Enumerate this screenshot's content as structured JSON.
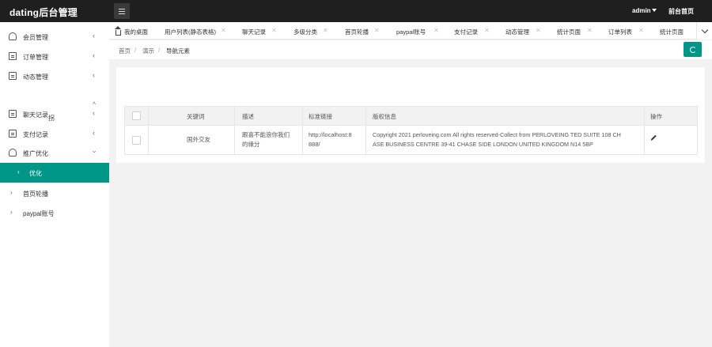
{
  "app": {
    "title": "dating后台管理",
    "user": "admin",
    "front_link": "前台首页"
  },
  "sidebar": {
    "items": [
      {
        "label": "会员管理",
        "icon": "user-icon"
      },
      {
        "label": "订单管理",
        "icon": "doc-icon"
      },
      {
        "label": "动态管理",
        "icon": "doc-icon"
      },
      {
        "label": "聊天记录",
        "icon": "doc-icon"
      },
      {
        "label": "支付记录",
        "icon": "doc-icon"
      },
      {
        "label": "推广优化",
        "icon": "group-icon"
      }
    ],
    "sub_fragment": "拐",
    "active_sub": "优化",
    "extra_items": [
      {
        "label": "首页轮播"
      },
      {
        "label": "paypal账号"
      }
    ]
  },
  "tabs": {
    "home": "我的桌面",
    "items": [
      "用户列表(静态表格)",
      "聊天记录",
      "多级分类",
      "首页轮播",
      "paypal账号",
      "支付记录",
      "动态管理",
      "统计页面",
      "订单列表",
      "统计页面"
    ]
  },
  "breadcrumb": [
    "首页",
    "演示",
    "导航元素"
  ],
  "table": {
    "headers": [
      "关键词",
      "描述",
      "标准链接",
      "版权信息",
      "操作"
    ],
    "rows": [
      {
        "keyword": "国外交友",
        "desc_lines": [
          "跟喜不能浪你我们",
          "的缘分"
        ],
        "link_lines": [
          "http://localhost:8",
          "888/"
        ],
        "copyright_lines": [
          "Copyright 2021 perloveing.com All rights reserved-Collect from PERLOVEING TED SUITE 108 CH",
          "ASE BUSINESS CENTRE 39-41 CHASE SIDE LONDON UNITED KINGDOM N14 5BP"
        ]
      }
    ]
  },
  "colors": {
    "topbar": "#1f1f1f",
    "accent": "#009688",
    "page_bg": "#f2f2f2"
  }
}
